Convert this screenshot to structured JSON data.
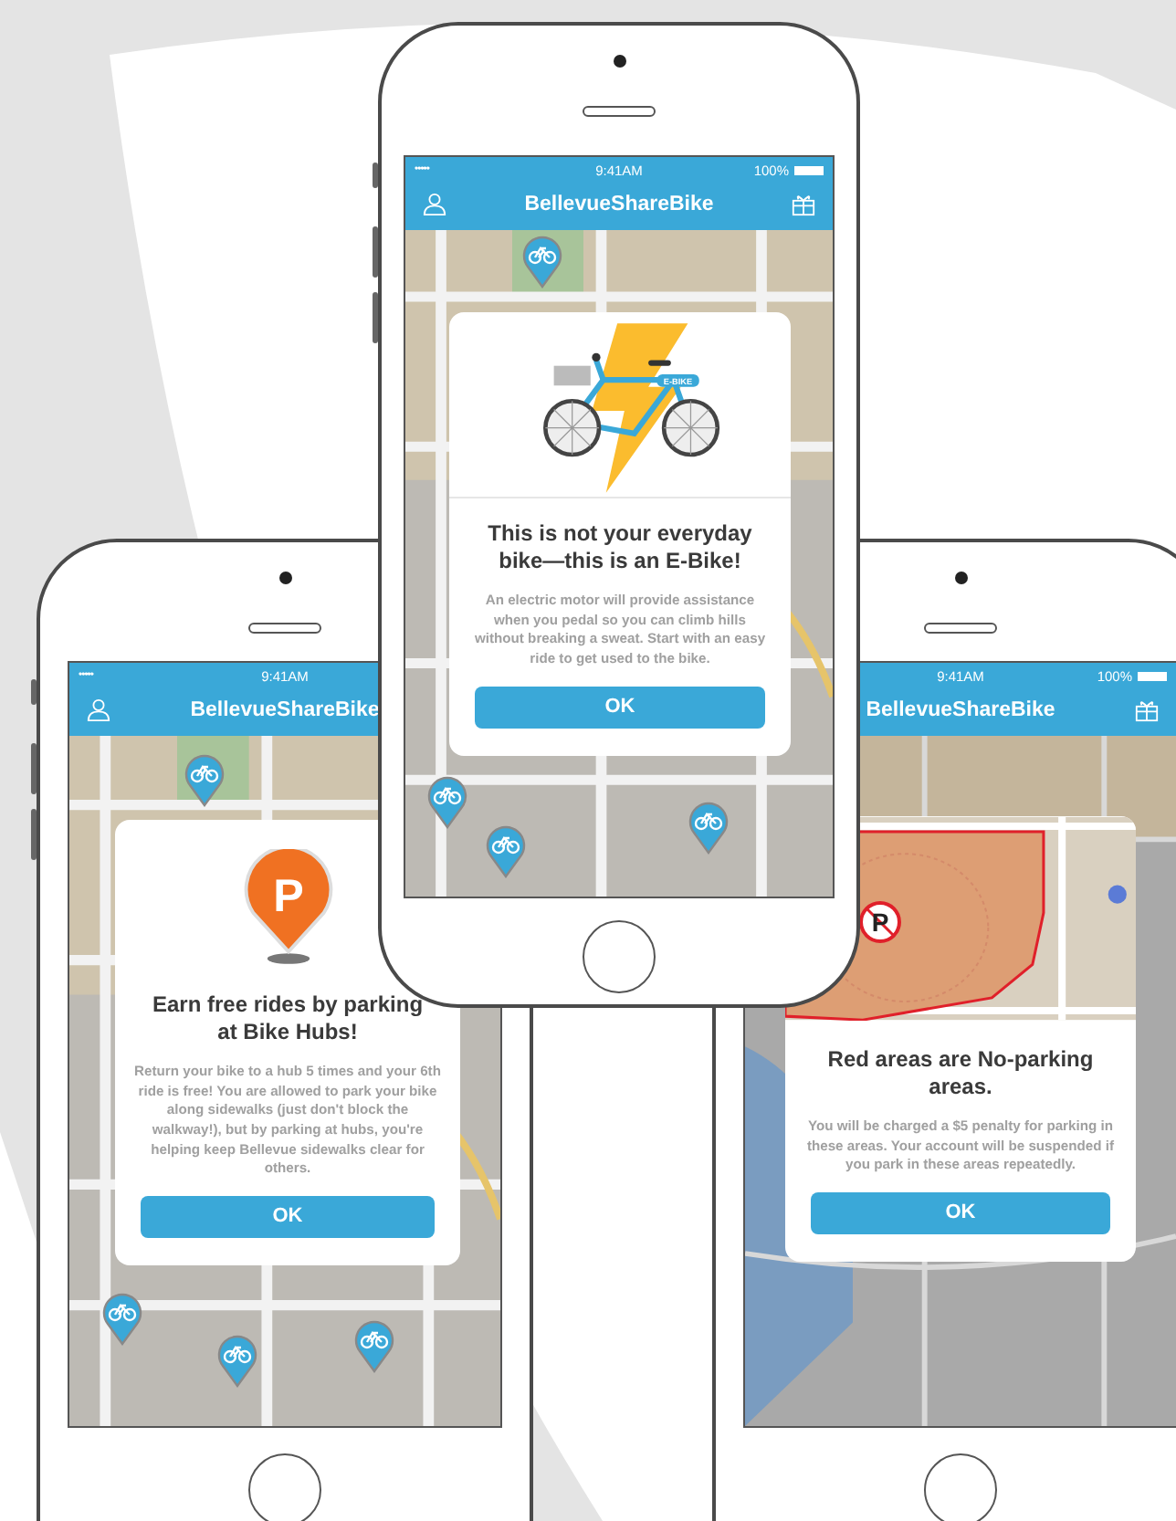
{
  "phones": [
    {
      "status": {
        "signal": "•••••",
        "time": "9:41AM",
        "battery": "100%"
      },
      "app_title": "BellevueShareBike",
      "dialog": {
        "kind": "ebike",
        "art_label": "E-BIKE",
        "title": "This is not your everyday bike—this is an E-Bike!",
        "body": "An electric motor will provide assistance when you pedal so you can climb hills without breaking a sweat. Start with an easy ride to get used to the bike.",
        "button": "OK"
      }
    },
    {
      "status": {
        "signal": "•••••",
        "time": "9:41AM"
      },
      "app_title": "BellevueShareBike",
      "dialog": {
        "kind": "hub",
        "art_label": "P",
        "title": "Earn free rides by parking at Bike Hubs!",
        "body": "Return your bike to a hub 5 times and your 6th ride is free! You are allowed to park your bike along sidewalks (just don't block the walkway!), but by parking at hubs, you're helping keep Bellevue sidewalks clear for others.",
        "button": "OK"
      }
    },
    {
      "status": {
        "time": "9:41AM",
        "battery": "100%"
      },
      "app_title": "BellevueShareBike",
      "dialog": {
        "kind": "no_parking",
        "art_label": "P",
        "title": "Red areas are No-parking areas.",
        "body": "You will be charged a $5 penalty for parking in these areas. Your account will be suspended if you park in these areas repeatedly.",
        "button": "OK"
      }
    }
  ]
}
